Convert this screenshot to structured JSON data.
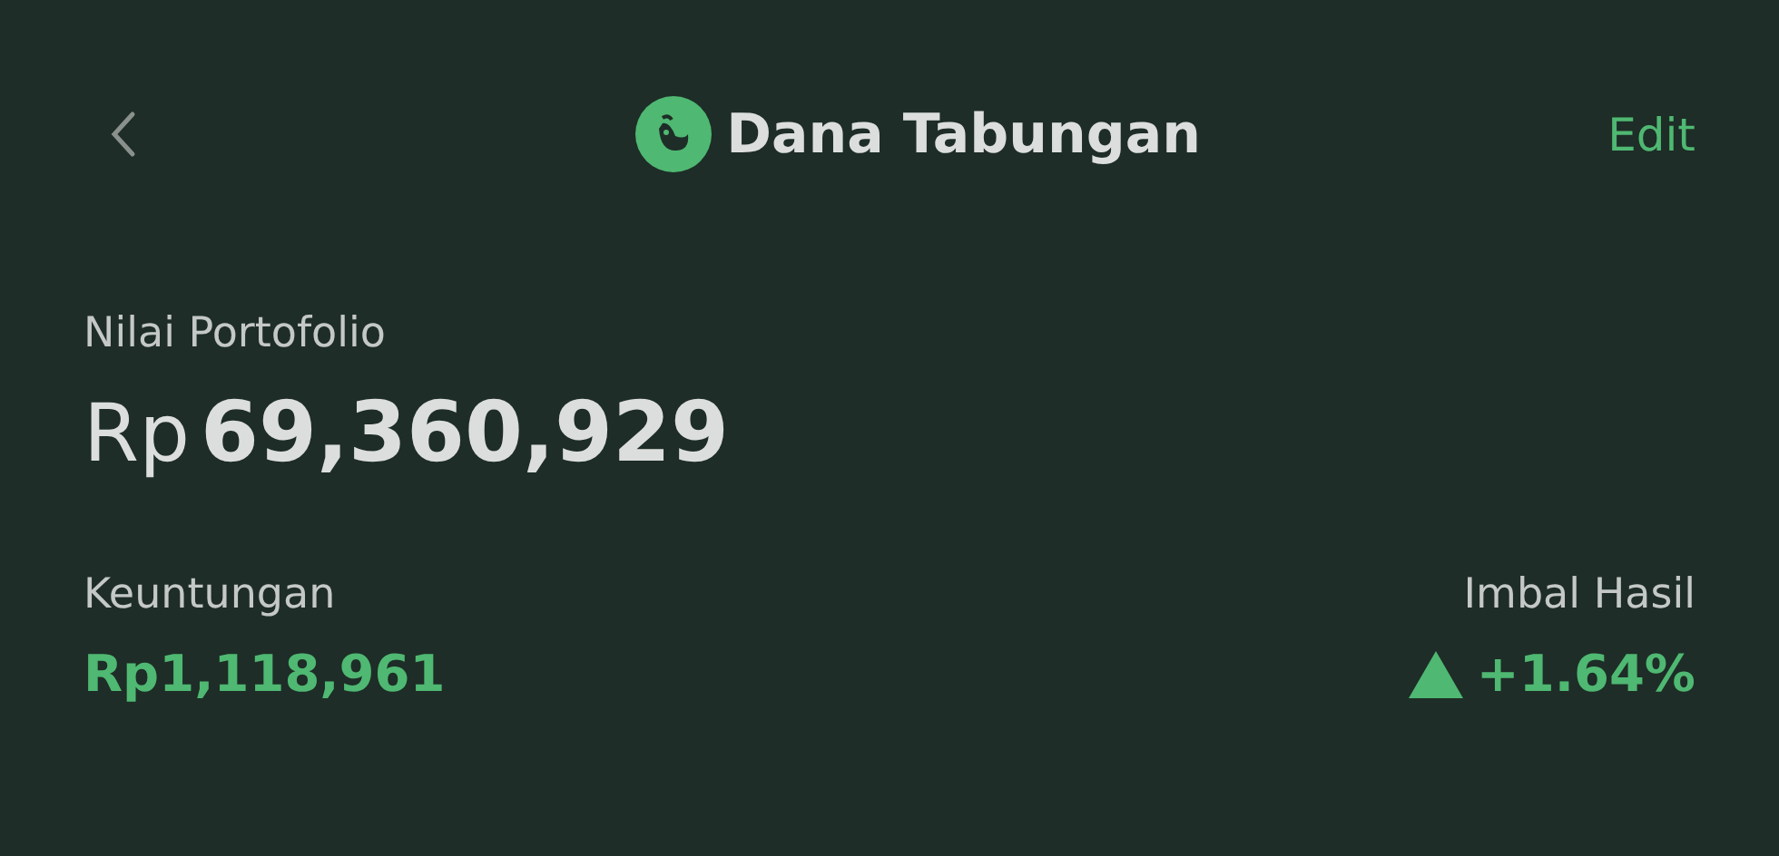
{
  "header": {
    "title": "Dana Tabungan",
    "action": "Edit"
  },
  "portfolio": {
    "label": "Nilai Portofolio",
    "currency": "Rp",
    "value": "69,360,929"
  },
  "profit": {
    "label": "Keuntungan",
    "value": "Rp1,118,961"
  },
  "return": {
    "label": "Imbal Hasil",
    "value": "+1.64%",
    "up": true
  }
}
